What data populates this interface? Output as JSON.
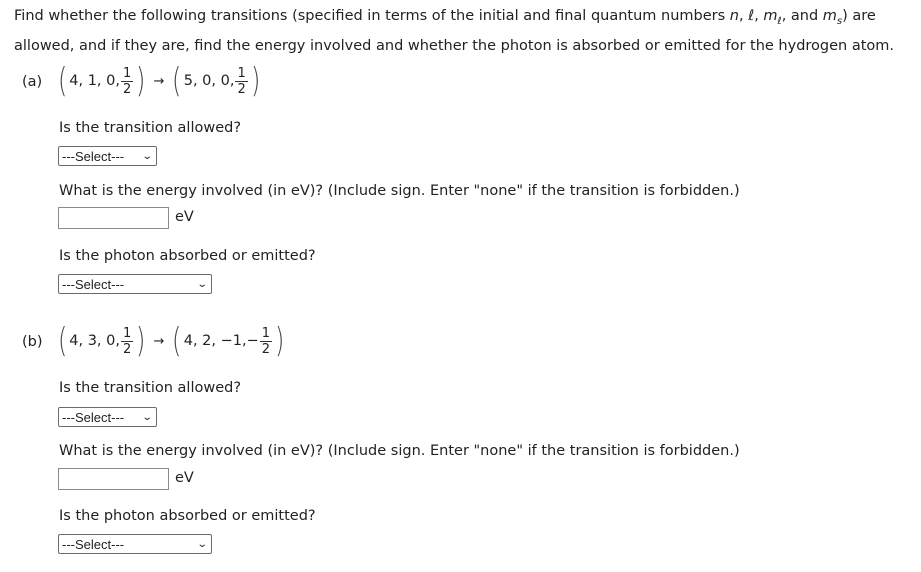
{
  "intro": {
    "pre": "Find whether the following transitions (specified in terms of the initial and final quantum numbers ",
    "n": "n",
    "comma1": ", ",
    "l": "ℓ",
    "comma2": ", ",
    "ml": "m",
    "ml_sub": "ℓ",
    "and": ", and ",
    "ms": "m",
    "ms_sub": "s",
    "post1": ") are",
    "line2": "allowed, and if they are, find the energy involved and whether the photon is absorbed or emitted for the hydrogen atom."
  },
  "parts": [
    {
      "label": "(a)",
      "initial": {
        "values": "4, 1, 0, ",
        "num": "1",
        "den": "2",
        "sign": ""
      },
      "final": {
        "values": "5, 0, 0, ",
        "num": "1",
        "den": "2",
        "sign": ""
      },
      "arrow": "→",
      "q_allowed": "Is the transition allowed?",
      "allowed_select": "---Select---",
      "q_energy": "What is the energy involved (in eV)? (Include sign. Enter \"none\" if the transition is forbidden.)",
      "energy_value": "",
      "energy_unit": "eV",
      "q_photon": "Is the photon absorbed or emitted?",
      "photon_select": "---Select---"
    },
    {
      "label": "(b)",
      "initial": {
        "values": "4, 3, 0, ",
        "num": "1",
        "den": "2",
        "sign": ""
      },
      "final": {
        "values": "4, 2, −1, ",
        "num": "1",
        "den": "2",
        "sign": "−"
      },
      "arrow": "→",
      "q_allowed": "Is the transition allowed?",
      "allowed_select": "---Select---",
      "q_energy": "What is the energy involved (in eV)? (Include sign. Enter \"none\" if the transition is forbidden.)",
      "energy_value": "",
      "energy_unit": "eV",
      "q_photon": "Is the photon absorbed or emitted?",
      "photon_select": "---Select---"
    }
  ]
}
